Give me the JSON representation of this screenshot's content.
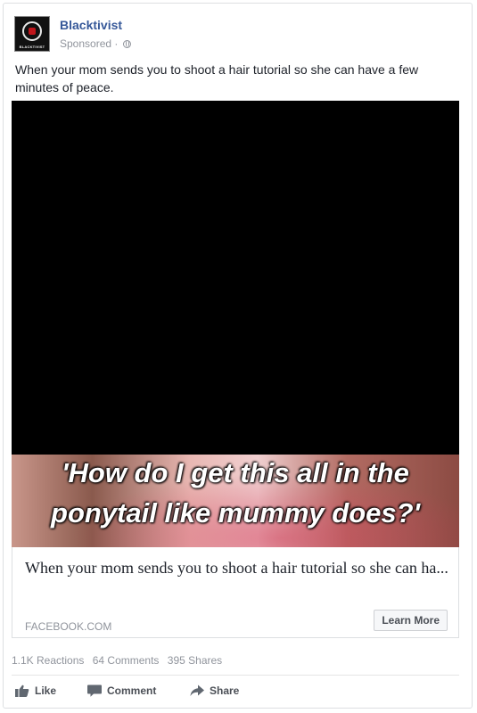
{
  "post": {
    "page_name": "Blacktivist",
    "avatar_text": "BLACKTIVIST",
    "sponsored": "Sponsored ·",
    "caption": "When your mom sends you to shoot a hair tutorial so she can have a few minutes of peace."
  },
  "thumbnail": {
    "line1": "'How do I get this all in the",
    "line2": "ponytail like mummy does?'"
  },
  "link": {
    "title": "When your mom sends you to shoot a hair tutorial so she can ha...",
    "domain": "FACEBOOK.COM",
    "cta": "Learn More"
  },
  "stats": {
    "reactions": "1.1K Reactions",
    "comments": "64 Comments",
    "shares": "395 Shares"
  },
  "actions": {
    "like": "Like",
    "comment": "Comment",
    "share": "Share"
  },
  "icons": {
    "globe": "globe-icon",
    "like": "thumbs-up-icon",
    "comment": "speech-bubble-icon",
    "share": "share-arrow-icon"
  },
  "colors": {
    "link_blue": "#365899",
    "meta_gray": "#90949c",
    "action_gray": "#4b4f56"
  }
}
